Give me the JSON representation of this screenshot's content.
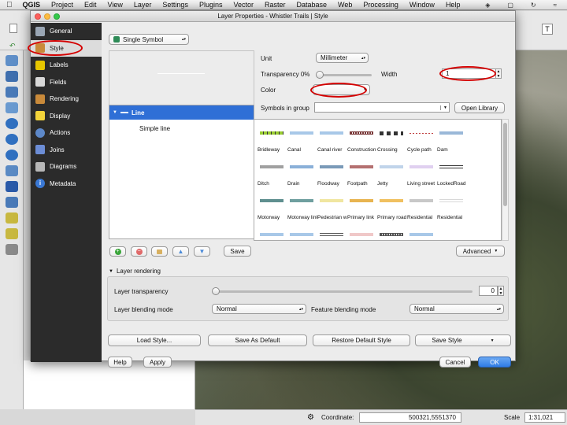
{
  "menubar": {
    "apple": "",
    "app": "QGIS",
    "items": [
      "Project",
      "Edit",
      "View",
      "Layer",
      "Settings",
      "Plugins",
      "Vector",
      "Raster",
      "Database",
      "Web",
      "Processing",
      "Window",
      "Help"
    ]
  },
  "statusbar": {
    "coordinate_label": "Coordinate:",
    "coordinate_value": "500321,5551370",
    "scale_label": "Scale",
    "scale_value": "1:31,021"
  },
  "dialog": {
    "title": "Layer Properties - Whistler Trails | Style",
    "sidebar": [
      {
        "label": "General",
        "icon": "wrench-icon",
        "color": "#9aa6b4"
      },
      {
        "label": "Style",
        "icon": "brush-icon",
        "color": "#c98a3a",
        "active": true
      },
      {
        "label": "Labels",
        "icon": "abc-labels-icon",
        "color": "#e6c600"
      },
      {
        "label": "Fields",
        "icon": "fields-table-icon",
        "color": "#d8d8d8"
      },
      {
        "label": "Rendering",
        "icon": "paintbrush-icon",
        "color": "#c98a3a"
      },
      {
        "label": "Display",
        "icon": "speech-bubble-icon",
        "color": "#f2d33a"
      },
      {
        "label": "Actions",
        "icon": "gear-actions-icon",
        "color": "#5d88c9"
      },
      {
        "label": "Joins",
        "icon": "joins-icon",
        "color": "#6c8dd6"
      },
      {
        "label": "Diagrams",
        "icon": "diagrams-icon",
        "color": "#b7b7b7"
      },
      {
        "label": "Metadata",
        "icon": "info-icon",
        "color": "#3a78d4"
      }
    ],
    "renderer": "Single Symbol",
    "tree": {
      "root": "Line",
      "child": "Simple line"
    },
    "save_label": "Save",
    "unit_label": "Unit",
    "unit_value": "Millimeter",
    "transparency_label": "Transparency 0%",
    "width_label": "Width",
    "width_value": "1",
    "color_label": "Color",
    "symbols_in_group_label": "Symbols in group",
    "open_library_label": "Open Library",
    "advanced_label": "Advanced",
    "symbols": [
      {
        "name": "Bridleway",
        "color": "#9acd32",
        "style": "dashed"
      },
      {
        "name": "Canal",
        "color": "#a8c8e8",
        "style": "solid"
      },
      {
        "name": "Canal river",
        "color": "#a8c8e8",
        "style": "solid"
      },
      {
        "name": "Construction",
        "color": "#7a3a3a",
        "style": "dotted"
      },
      {
        "name": "Crossing",
        "color": "#333333",
        "style": "boxes"
      },
      {
        "name": "Cycle path",
        "color": "#c04040",
        "style": "dashed-thin"
      },
      {
        "name": "Dam",
        "color": "#9ab8d8",
        "style": "solid"
      },
      {
        "name": "Ditch",
        "color": "#a0a0a0",
        "style": "solid"
      },
      {
        "name": "Drain",
        "color": "#8ab0d8",
        "style": "solid"
      },
      {
        "name": "Floodway",
        "color": "#7a9ab8",
        "style": "solid"
      },
      {
        "name": "Footpath",
        "color": "#b47070",
        "style": "solid"
      },
      {
        "name": "Jetty",
        "color": "#c0d4ea",
        "style": "solid"
      },
      {
        "name": "Living street",
        "color": "#e0d0f0",
        "style": "solid"
      },
      {
        "name": "LockedRoad",
        "color": "#333333",
        "style": "double"
      },
      {
        "name": "Motorway",
        "color": "#5f8f8f",
        "style": "solid"
      },
      {
        "name": "Motorway link",
        "color": "#6f9f9f",
        "style": "solid"
      },
      {
        "name": "Pedestrian way",
        "color": "#f0e6a0",
        "style": "solid"
      },
      {
        "name": "Primary link",
        "color": "#e8b450",
        "style": "solid"
      },
      {
        "name": "Primary road",
        "color": "#f0c060",
        "style": "solid"
      },
      {
        "name": "Residential",
        "color": "#c8c8c8",
        "style": "solid"
      },
      {
        "name": "Residential",
        "color": "#d8d8d8",
        "style": "double"
      },
      {
        "name": "",
        "color": "#a8c8e8",
        "style": "solid"
      },
      {
        "name": "",
        "color": "#a8c8e8",
        "style": "solid"
      },
      {
        "name": "",
        "color": "#555555",
        "style": "double"
      },
      {
        "name": "",
        "color": "#f0c8c8",
        "style": "solid"
      },
      {
        "name": "",
        "color": "#555555",
        "style": "dotted"
      },
      {
        "name": "",
        "color": "#a8c8e8",
        "style": "solid"
      },
      {
        "name": "",
        "color": "#ffffff",
        "style": "solid"
      }
    ],
    "layer_rendering_label": "Layer rendering",
    "layer_transparency_label": "Layer transparency",
    "layer_transparency_value": "0",
    "layer_blending_label": "Layer blending mode",
    "layer_blending_value": "Normal",
    "feature_blending_label": "Feature blending mode",
    "feature_blending_value": "Normal",
    "load_style_label": "Load Style...",
    "save_default_label": "Save As Default",
    "restore_default_label": "Restore Default Style",
    "save_style_label": "Save Style",
    "help_label": "Help",
    "apply_label": "Apply",
    "cancel_label": "Cancel",
    "ok_label": "OK"
  }
}
